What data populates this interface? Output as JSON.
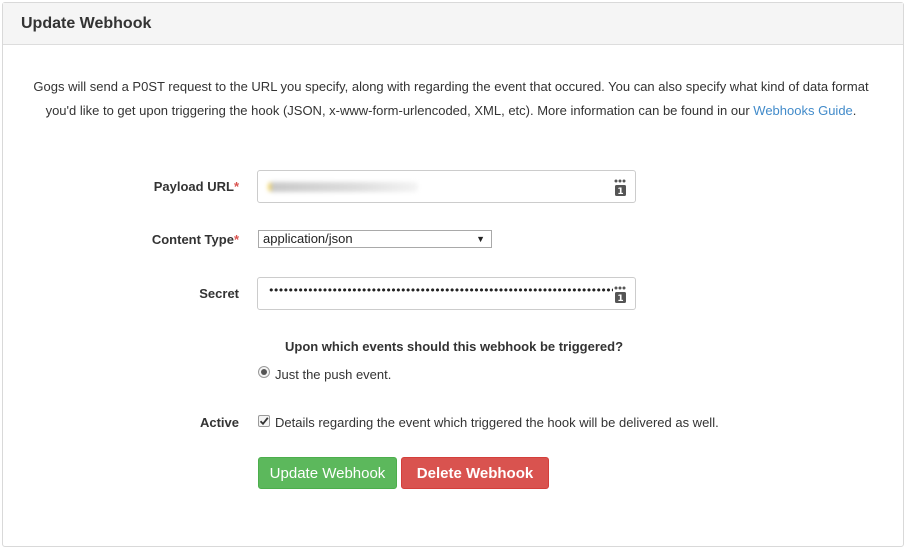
{
  "panel": {
    "title": "Update Webhook"
  },
  "description": {
    "text": "Gogs will send a P0ST request to the URL you specify, along with regarding the event that occured. You can also specify what kind of data format you'd like to get upon triggering the hook (JSON, x-www-form-urlencoded, XML, etc). More information can be found in our ",
    "link_label": "Webhooks Guide",
    "suffix": "."
  },
  "form": {
    "payload_url": {
      "label": "Payload URL",
      "required_mark": "*",
      "value": ""
    },
    "content_type": {
      "label": "Content Type",
      "required_mark": "*",
      "selected": "application/json"
    },
    "secret": {
      "label": "Secret",
      "masked_value": "••••••••••••••••••••••••••••••••••••••••••••••••••••••••••••••••••••••••••••"
    },
    "events": {
      "question": "Upon which events should this webhook be triggered?",
      "option_label": "Just the push event.",
      "selected": true
    },
    "active": {
      "label": "Active",
      "description": "Details regarding the event which triggered the hook will be delivered as well.",
      "checked": true
    }
  },
  "buttons": {
    "update": "Update Webhook",
    "delete": "Delete Webhook"
  },
  "colors": {
    "link": "#428bca",
    "required": "#d9534f",
    "update_button": "#5cb85c",
    "delete_button": "#d9534f"
  }
}
